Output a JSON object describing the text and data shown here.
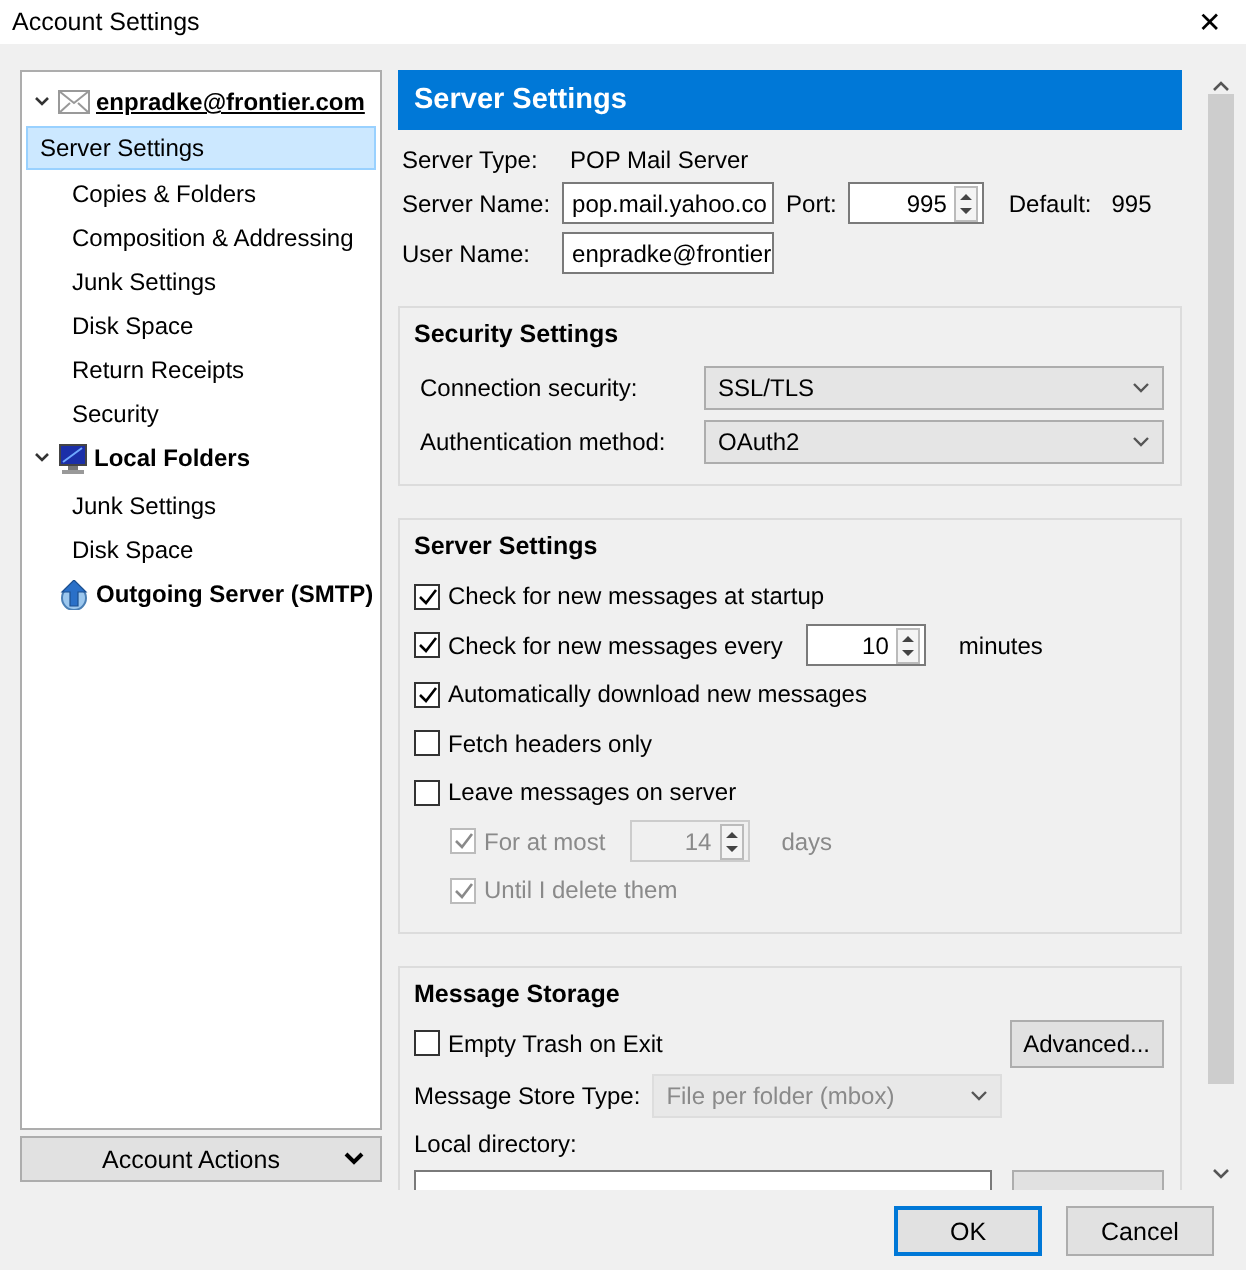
{
  "window": {
    "title": "Account Settings",
    "close": "✕"
  },
  "sidebar": {
    "tree": [
      {
        "label": "enpradke@frontier.com",
        "kind": "mail",
        "expanded": true,
        "selected": false,
        "children": [
          {
            "label": "Server Settings",
            "selected": true
          },
          {
            "label": "Copies & Folders",
            "selected": false
          },
          {
            "label": "Composition & Addressing",
            "selected": false
          },
          {
            "label": "Junk Settings",
            "selected": false
          },
          {
            "label": "Disk Space",
            "selected": false
          },
          {
            "label": "Return Receipts",
            "selected": false
          },
          {
            "label": "Security",
            "selected": false
          }
        ]
      },
      {
        "label": "Local Folders",
        "kind": "local",
        "expanded": true,
        "selected": false,
        "children": [
          {
            "label": "Junk Settings",
            "selected": false
          },
          {
            "label": "Disk Space",
            "selected": false
          }
        ]
      },
      {
        "label": "Outgoing Server (SMTP)",
        "kind": "smtp",
        "selected": false
      }
    ],
    "account_actions": "Account Actions"
  },
  "content": {
    "header": "Server Settings",
    "server_type": {
      "label": "Server Type:",
      "value": "POP Mail Server"
    },
    "server_name": {
      "label": "Server Name:",
      "value": "pop.mail.yahoo.co"
    },
    "port": {
      "label": "Port:",
      "value": "995"
    },
    "default": {
      "label": "Default:",
      "value": "995"
    },
    "user_name": {
      "label": "User Name:",
      "value": "enpradke@frontier"
    },
    "security": {
      "title": "Security Settings",
      "rows": [
        {
          "label": "Connection security:",
          "value": "SSL/TLS"
        },
        {
          "label": "Authentication method:",
          "value": "OAuth2"
        }
      ]
    },
    "server_settings": {
      "title": "Server Settings",
      "options": [
        {
          "kind": "checkbox",
          "label": "Check for new messages at startup",
          "checked": true,
          "disabled": false
        },
        {
          "kind": "interval",
          "label": "Check for new messages every",
          "checked": true,
          "disabled": false,
          "value": "10",
          "unit": "minutes"
        },
        {
          "kind": "checkbox",
          "label": "Automatically download new messages",
          "checked": true,
          "disabled": false
        },
        {
          "kind": "checkbox",
          "label": "Fetch headers only",
          "checked": false,
          "disabled": false
        },
        {
          "kind": "checkbox",
          "label": "Leave messages on server",
          "checked": false,
          "disabled": false,
          "children": [
            {
              "kind": "interval",
              "label": "For at most",
              "checked": true,
              "disabled": true,
              "value": "14",
              "unit": "days"
            },
            {
              "kind": "checkbox",
              "label": "Until I delete them",
              "checked": true,
              "disabled": true
            }
          ]
        }
      ]
    },
    "storage": {
      "title": "Message Storage",
      "empty_trash": {
        "label": "Empty Trash on Exit",
        "checked": false
      },
      "advanced": "Advanced...",
      "store_type": {
        "label": "Message Store Type:",
        "value": "File per folder (mbox)",
        "disabled": true
      },
      "local_directory": {
        "label": "Local directory:"
      }
    }
  },
  "buttons": [
    {
      "label": "OK",
      "default": true
    },
    {
      "label": "Cancel",
      "default": false
    }
  ]
}
